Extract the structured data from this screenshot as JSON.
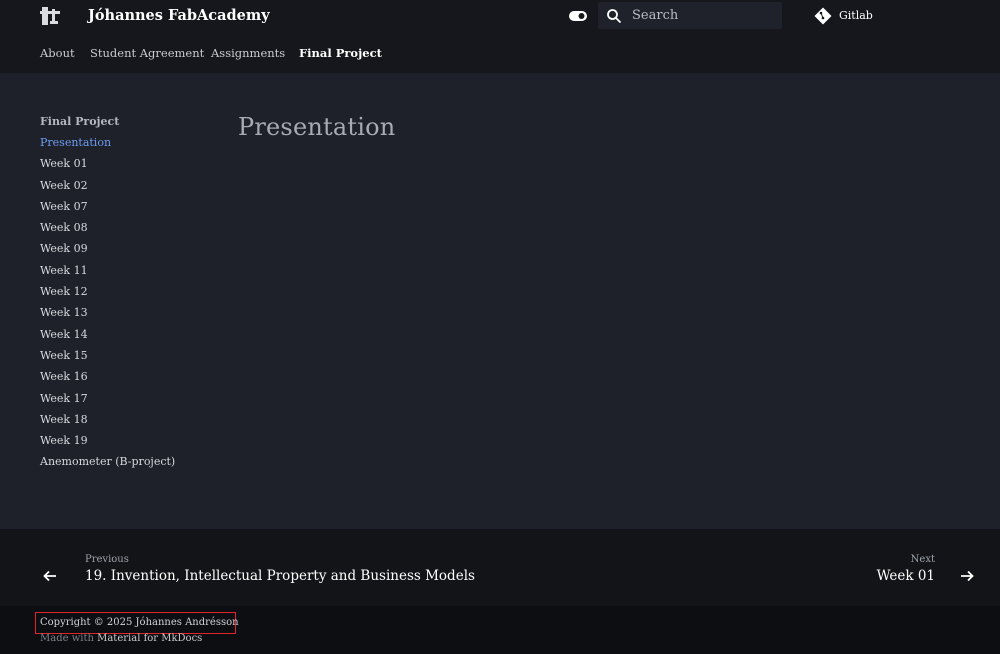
{
  "header": {
    "site_title": "Jóhannes FabAcademy",
    "search_placeholder": "Search",
    "repo_label": "Gitlab"
  },
  "tabs": [
    {
      "label": "About",
      "active": false
    },
    {
      "label": "Student Agreement",
      "active": false
    },
    {
      "label": "Assignments",
      "active": false
    },
    {
      "label": "Final Project",
      "active": true
    }
  ],
  "sidebar": {
    "title": "Final Project",
    "items": [
      {
        "label": "Presentation",
        "active": true
      },
      {
        "label": "Week 01"
      },
      {
        "label": "Week 02"
      },
      {
        "label": "Week 07"
      },
      {
        "label": "Week 08"
      },
      {
        "label": "Week 09"
      },
      {
        "label": "Week 11"
      },
      {
        "label": "Week 12"
      },
      {
        "label": "Week 13"
      },
      {
        "label": "Week 14"
      },
      {
        "label": "Week 15"
      },
      {
        "label": "Week 16"
      },
      {
        "label": "Week 17"
      },
      {
        "label": "Week 18"
      },
      {
        "label": "Week 19"
      },
      {
        "label": "Anemometer (B-project)"
      }
    ]
  },
  "main": {
    "heading": "Presentation"
  },
  "footer_nav": {
    "previous_label": "Previous",
    "previous_title": "19. Invention, Intellectual Property and Business Models",
    "next_label": "Next",
    "next_title": "Week 01"
  },
  "footer_meta": {
    "copyright": "Copyright © 2025 Jóhannes Andrésson",
    "made_with_prefix": "Made with",
    "made_with_link": "Material for MkDocs"
  },
  "colors": {
    "header_bg": "#15171c",
    "body_bg": "#1e2129",
    "accent": "#6d9df0",
    "highlight_border": "#e0242b"
  }
}
